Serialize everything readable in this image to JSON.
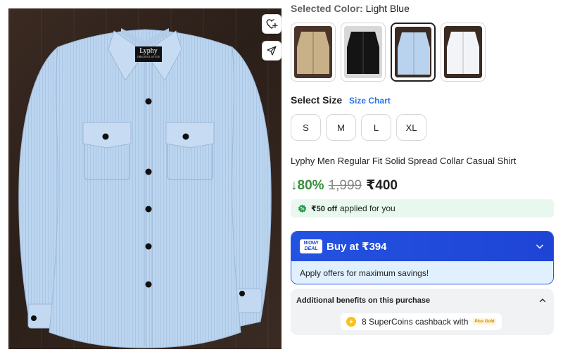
{
  "product_image": {
    "brand_label": "Lyphy",
    "brand_sub": "ORIGINAL STYLE"
  },
  "icons": {
    "wishlist": "heart-plus-icon",
    "share": "share-paper-plane-icon"
  },
  "color": {
    "label": "Selected Color:",
    "value": "Light Blue",
    "swatches": [
      "khaki",
      "black",
      "light-blue",
      "white"
    ],
    "selected_index": 2
  },
  "size": {
    "label": "Select Size",
    "chart_link": "Size Chart",
    "options": [
      "S",
      "M",
      "L",
      "XL"
    ]
  },
  "product": {
    "title": "Lyphy Men Regular Fit Solid Spread Collar Casual Shirt"
  },
  "price": {
    "discount": "↓80%",
    "mrp": "1,999",
    "final": "₹400"
  },
  "coupon": {
    "amount": "₹50 off",
    "text": "applied for you"
  },
  "deal": {
    "badge_line1": "WOW!",
    "badge_line2": "DEAL",
    "buy_label": "Buy at ₹394",
    "subtext": "Apply offers for maximum savings!"
  },
  "benefits": {
    "title": "Additional benefits on this purchase",
    "coins_text": "8 SuperCoins cashback with",
    "plus_label": "Plus Gold"
  },
  "colors": {
    "accent_blue": "#2874f0",
    "deal_blue": "#1e44d6",
    "discount_green": "#388e3c",
    "coupon_bg": "#e8f8ee",
    "shirt_blue": "#b9d3ee"
  }
}
